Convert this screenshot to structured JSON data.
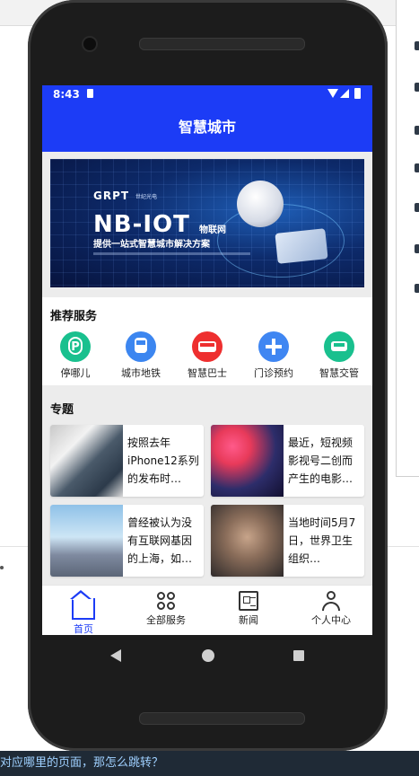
{
  "status_bar": {
    "time": "8:43"
  },
  "app_bar": {
    "title": "智慧城市"
  },
  "banner": {
    "brand": "GRPT",
    "brand_sub": "世纪光电",
    "headline": "NB-IOT",
    "headline_small": "物联网",
    "tagline": "提供一站式智慧城市解决方案",
    "page_count": 3,
    "active_page": 1
  },
  "services": {
    "title": "推荐服务",
    "items": [
      {
        "label": "停哪儿",
        "icon": "parking-icon",
        "color": "#19c08e"
      },
      {
        "label": "城市地铁",
        "icon": "metro-icon",
        "color": "#3c86f0"
      },
      {
        "label": "智慧巴士",
        "icon": "bus-icon",
        "color": "#ee2f2f"
      },
      {
        "label": "门诊预约",
        "icon": "clinic-plus-icon",
        "color": "#3f86f2"
      },
      {
        "label": "智慧交管",
        "icon": "car-icon",
        "color": "#19c08e"
      }
    ]
  },
  "topics": {
    "title": "专题",
    "cards": [
      {
        "text": "按照去年iPhone12系列的发布时…"
      },
      {
        "text": "最近，短视频影视号二创而产生的电影…"
      },
      {
        "text": "曾经被认为没有互联网基因的上海，如…"
      },
      {
        "text": "当地时间5月7日，世界卫生组织…"
      }
    ]
  },
  "tabs": [
    {
      "label": "首页",
      "icon": "home-icon",
      "active": true
    },
    {
      "label": "全部服务",
      "icon": "grid-icon",
      "active": false
    },
    {
      "label": "新闻",
      "icon": "news-icon",
      "active": false
    },
    {
      "label": "个人中心",
      "icon": "user-icon",
      "active": false
    }
  ],
  "background": {
    "bottom_text": "对应哪里的页面，那怎么跳转？"
  },
  "colors": {
    "primary": "#1c3cf6",
    "screen_bg": "#ececec"
  }
}
